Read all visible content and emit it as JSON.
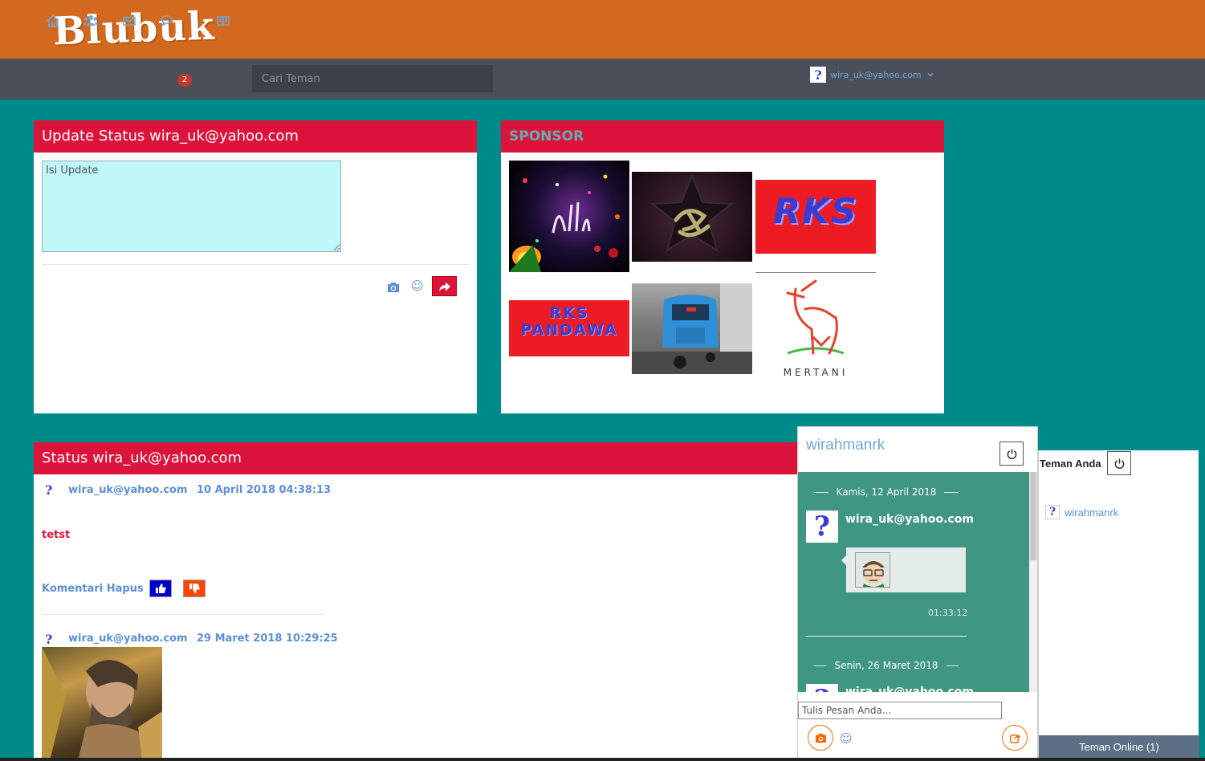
{
  "brand": {
    "logo_text": "Blubuk",
    "header_color": "#d2691e"
  },
  "nav": {
    "icons": [
      "home-icon",
      "friends-icon",
      "mail-icon",
      "chat-icon",
      "book-icon"
    ],
    "chat_badge": "2",
    "search_placeholder": "Cari Teman",
    "user_email": "wira_uk@yahoo.com"
  },
  "update_panel": {
    "title": "Update Status wira_uk@yahoo.com",
    "textarea_placeholder": "Isi Update",
    "textarea_value": ""
  },
  "sponsor_panel": {
    "title": "SPONSOR",
    "items": [
      {
        "kind": "photo",
        "name": "allah-calligraphy"
      },
      {
        "kind": "photo",
        "name": "muhammad-calligraphy-star"
      },
      {
        "kind": "logo",
        "text": "RKS"
      },
      {
        "kind": "logo",
        "text": "RKS PANDAWA"
      },
      {
        "kind": "photo",
        "name": "blue-bajaj"
      },
      {
        "kind": "logo",
        "text": "MERTANI"
      }
    ]
  },
  "status_panel": {
    "title": "Status wira_uk@yahoo.com",
    "posts": [
      {
        "user": "wira_uk@yahoo.com",
        "time": "10 April 2018 04:38:13",
        "text": "tetst",
        "actions": "Komentari Hapus"
      },
      {
        "user": "wira_uk@yahoo.com",
        "time": "29 Maret 2018 10:29:25",
        "text": ""
      }
    ]
  },
  "chat": {
    "title": "wirahmanrk",
    "days": [
      {
        "date": "Kamis, 12 April 2018",
        "messages": [
          {
            "user": "wira_uk@yahoo.com",
            "time": "01:33:12",
            "content": "sticker"
          }
        ]
      },
      {
        "date": "Senin, 26 Maret 2018",
        "messages": [
          {
            "user": "wira_uk@yahoo.com"
          }
        ]
      }
    ],
    "input_placeholder": "Tulis Pesan Anda..."
  },
  "friends": {
    "title": "Teman Anda",
    "items": [
      {
        "name": "wirahmanrk"
      }
    ],
    "online_label": "Teman Online (1)"
  }
}
